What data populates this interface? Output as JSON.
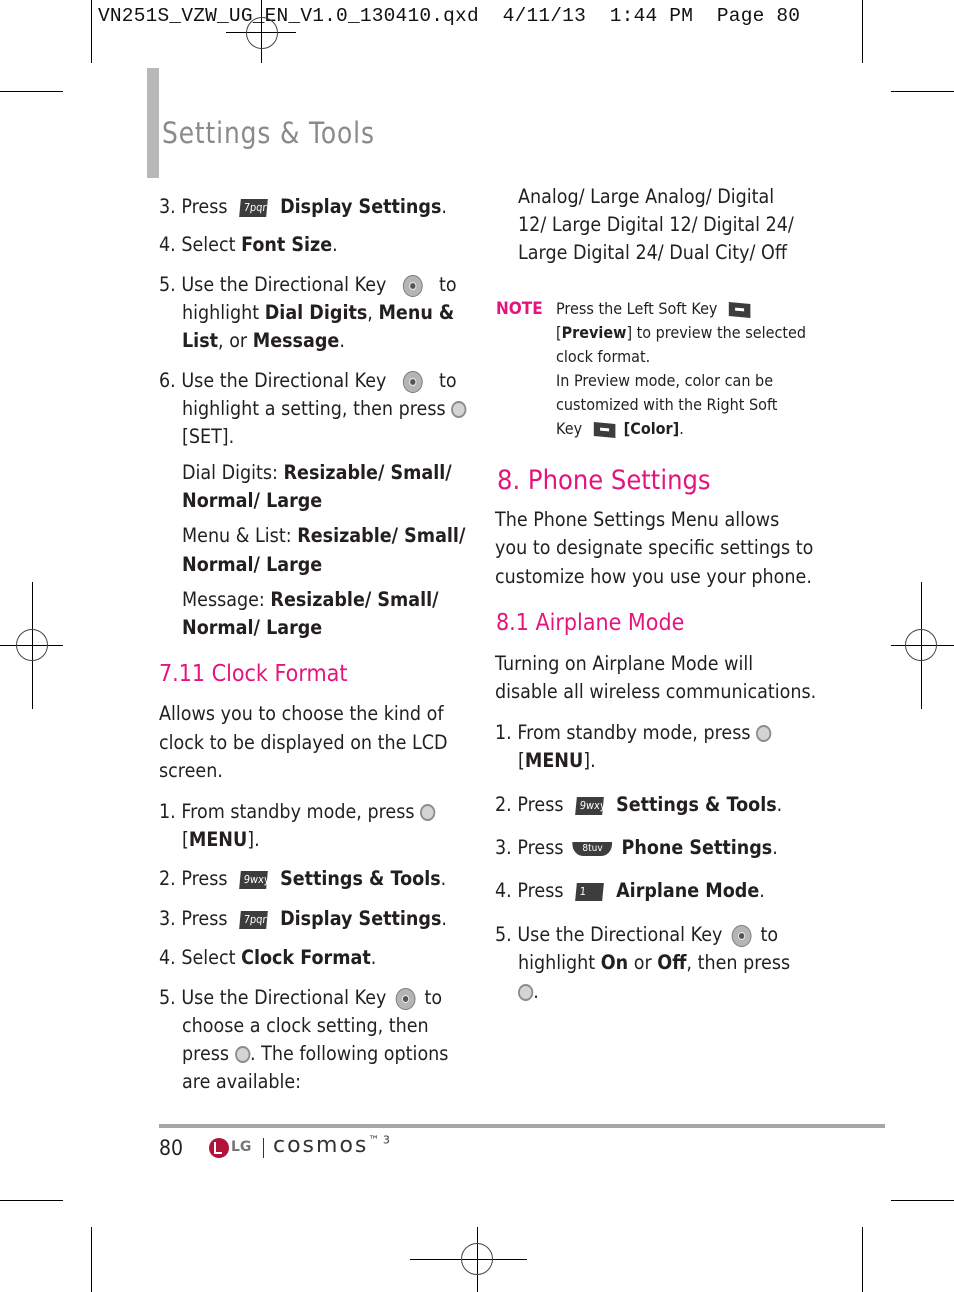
{
  "slug_line": "VN251S_VZW_UG_EN_V1.0_130410.qxd  4/11/13  1:44 PM  Page 80",
  "header": {
    "title": "Settings & Tools"
  },
  "left_column": {
    "steps_top": [
      {
        "num": "3.",
        "pre": "Press",
        "key": "7pqrs",
        "bold": "Display Settings",
        "post": "."
      },
      {
        "num": "4.",
        "pre": "Select",
        "bold": "Font Size",
        "post": "."
      }
    ],
    "step5": {
      "num": "5.",
      "line1": "Use the Directional Key",
      "line1_end": "to",
      "line2_pre": "highlight",
      "line2_b1": "Dial Digits",
      "line2_sep": ",",
      "line2_b2": "Menu &",
      "line3_b": "List",
      "line3_mid": ", or",
      "line3_b2": "Message",
      "line3_post": "."
    },
    "step6": {
      "num": "6.",
      "line1": "Use the Directional Key",
      "line1_end": "to",
      "line2": "highlight a setting, then press",
      "line3": "[SET]."
    },
    "options": [
      {
        "label": "Dial Digits:",
        "values_line1": "Resizable/ Small/",
        "values_line2": "Normal/ Large"
      },
      {
        "label": "Menu & List:",
        "values_line1": "Resizable/ Small/",
        "values_line2": "Normal/ Large"
      },
      {
        "label": "Message:",
        "values_line1": "Resizable/ Small/",
        "values_line2": "Normal/ Large"
      }
    ],
    "clock_format": {
      "heading": "7.11 Clock Format",
      "intro": [
        "Allows you to choose the kind of",
        "clock to be displayed on the LCD",
        "screen."
      ],
      "step1": {
        "num": "1.",
        "line1": "From standby mode, press",
        "line2_open": "[",
        "line2_b": "MENU",
        "line2_close": "]."
      },
      "step2": {
        "num": "2.",
        "pre": "Press",
        "key": "9wxyz",
        "bold": "Settings & Tools",
        "post": "."
      },
      "step3": {
        "num": "3.",
        "pre": "Press",
        "key": "7pqrs",
        "bold": "Display Settings",
        "post": "."
      },
      "step4": {
        "num": "4.",
        "pre": "Select",
        "bold": "Clock Format",
        "post": "."
      },
      "step5": {
        "num": "5.",
        "line1": "Use the Directional Key",
        "line1_end": "to",
        "line2": "choose a clock setting, then",
        "line3_pre": "press",
        "line3_post": ". The following options",
        "line4": "are available:"
      }
    }
  },
  "right_column": {
    "clock_options": [
      "Analog/ Large Analog/ Digital",
      "12/ Large Digital 12/ Digital 24/",
      "Large Digital 24/ Dual City/ Off"
    ],
    "note": {
      "label": "NOTE",
      "line1": "Press the Left Soft Key",
      "line2_open": "[",
      "line2_b": "Preview",
      "line2_post": "] to preview the selected",
      "line3": "clock format.",
      "line4": "In Preview mode, color can be",
      "line5": "customized with the Right Soft",
      "line6_pre": "Key",
      "line6_b": "[Color]",
      "line6_post": "."
    },
    "phone_settings": {
      "heading": "8. Phone Settings",
      "intro": [
        "The Phone Settings Menu allows",
        "you to designate specific settings to",
        "customize how you use your phone."
      ]
    },
    "airplane_mode": {
      "heading": "8.1 Airplane Mode",
      "intro": [
        "Turning on Airplane Mode will",
        "disable all wireless communications."
      ],
      "step1": {
        "num": "1.",
        "line1": "From standby mode, press",
        "line2_open": "[",
        "line2_b": "MENU",
        "line2_close": "]."
      },
      "step2": {
        "num": "2.",
        "pre": "Press",
        "key": "9wxyz",
        "bold": "Settings & Tools",
        "post": "."
      },
      "step3": {
        "num": "3.",
        "pre": "Press",
        "key": "8tuv",
        "bold": "Phone Settings",
        "post": "."
      },
      "step4": {
        "num": "4.",
        "pre": "Press",
        "key": "1",
        "bold": "Airplane Mode",
        "post": "."
      },
      "step5": {
        "num": "5.",
        "line1": "Use the Directional Key",
        "line1_end": "to",
        "line2_pre": "highlight",
        "line2_b1": "On",
        "line2_mid": "or",
        "line2_b2": "Off",
        "line2_post": ", then press",
        "line3_post": "."
      }
    }
  },
  "footer": {
    "page_number": "80",
    "lg": "LG",
    "brand": "cosmos",
    "brand_sup": "™ 3"
  },
  "colors": {
    "accent": "#e5147d",
    "title_gray": "#8a8a8a",
    "bar_gray": "#b8b8b8",
    "rule_gray": "#a6a6a6"
  }
}
